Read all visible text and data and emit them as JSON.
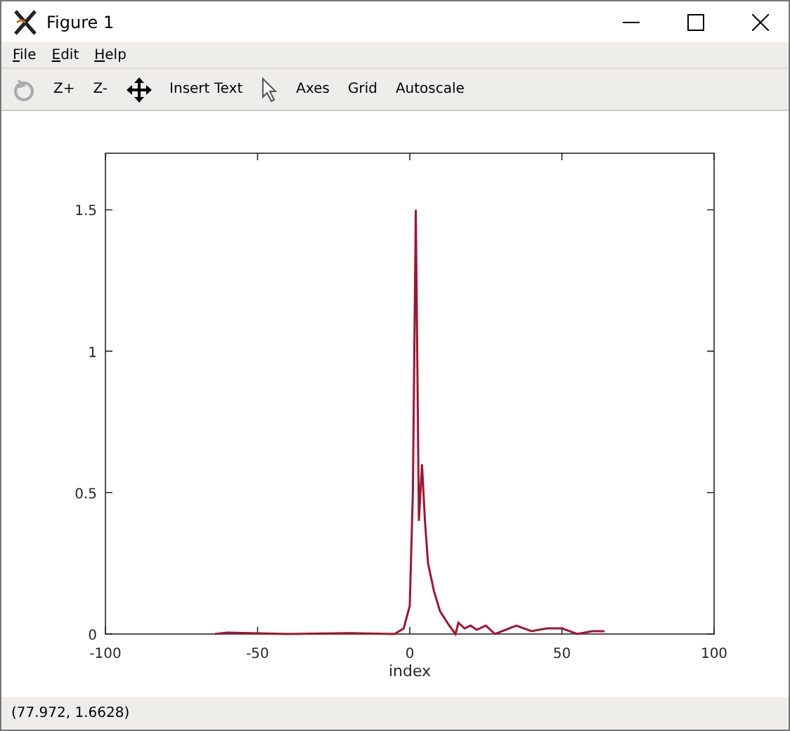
{
  "window": {
    "title": "Figure 1"
  },
  "menu": [
    {
      "label": "File"
    },
    {
      "label": "Edit"
    },
    {
      "label": "Help"
    }
  ],
  "toolbar": [
    {
      "kind": "rotate",
      "disabled": true
    },
    {
      "kind": "text",
      "label": "Z+"
    },
    {
      "kind": "text",
      "label": "Z-"
    },
    {
      "kind": "pan"
    },
    {
      "kind": "text",
      "label": "Insert Text"
    },
    {
      "kind": "select"
    },
    {
      "kind": "text",
      "label": "Axes"
    },
    {
      "kind": "text",
      "label": "Grid"
    },
    {
      "kind": "text",
      "label": "Autoscale"
    }
  ],
  "plot": {
    "chart_data": {
      "type": "line",
      "xlabel": "index",
      "xlim": [
        -100,
        100
      ],
      "ylim": [
        0,
        1.7
      ],
      "xticks": [
        -100,
        -50,
        0,
        50,
        100
      ],
      "yticks": [
        0,
        0.5,
        1,
        1.5
      ],
      "x": [
        -64,
        -60,
        -40,
        -20,
        -5,
        -2,
        0,
        1,
        2,
        3,
        4,
        5,
        6,
        8,
        10,
        13,
        15,
        16,
        18,
        20,
        22,
        25,
        28,
        35,
        40,
        45,
        50,
        55,
        60,
        64
      ],
      "series": [
        {
          "color": "#a2142f",
          "values": [
            0,
            0.005,
            0,
            0.003,
            0,
            0.02,
            0.1,
            0.5,
            1.5,
            0.4,
            0.6,
            0.4,
            0.25,
            0.15,
            0.08,
            0.03,
            0,
            0.04,
            0.02,
            0.03,
            0.015,
            0.03,
            0,
            0.03,
            0.01,
            0.02,
            0.02,
            0,
            0.01,
            0.01
          ]
        }
      ]
    }
  },
  "status_bar": {
    "text": "(77.972, 1.6628)"
  }
}
